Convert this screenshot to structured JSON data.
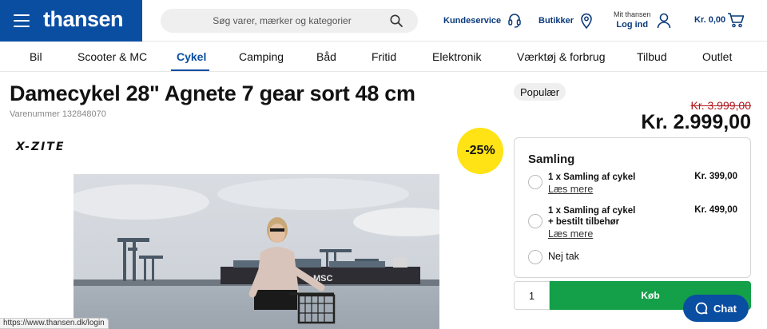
{
  "header": {
    "logo": "thansen",
    "search_placeholder": "Søg varer, mærker og kategorier",
    "customer_service": "Kundeservice",
    "stores": "Butikker",
    "account_top": "Mit thansen",
    "account_login": "Log ind",
    "cart_total": "Kr. 0,00"
  },
  "nav": {
    "items": [
      "Bil",
      "Scooter & MC",
      "Cykel",
      "Camping",
      "Båd",
      "Fritid",
      "Elektronik",
      "Værktøj & forbrug",
      "Tilbud",
      "Outlet"
    ],
    "active": "Cykel"
  },
  "product": {
    "title": "Damecykel 28\" Agnete 7 gear sort 48 cm",
    "sku": "Varenummer 132848070",
    "brand": "X-ZITE",
    "discount": "-25%",
    "badge": "Populær",
    "old_price": "Kr. 3.999,00",
    "price": "Kr. 2.999,00"
  },
  "assembly": {
    "title": "Samling",
    "options": [
      {
        "label_line1": "1 x Samling af cykel",
        "label_line2": "",
        "more": "Læs mere",
        "price": "Kr. 399,00"
      },
      {
        "label_line1": "1 x Samling af cykel",
        "label_line2": "+ bestilt tilbehør",
        "more": "Læs mere",
        "price": "Kr. 499,00"
      }
    ],
    "none_label": "Nej tak"
  },
  "buy": {
    "quantity": "1",
    "button": "Køb"
  },
  "chat": {
    "label": "Chat"
  },
  "status_url": "https://www.thansen.dk/login",
  "colors": {
    "brand_blue": "#0a4ea2",
    "buy_green": "#13a048",
    "discount_yellow": "#ffe315",
    "old_price_red": "#b0191e"
  }
}
